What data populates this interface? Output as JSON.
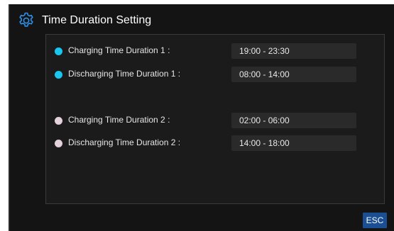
{
  "header": {
    "title": "Time Duration Setting",
    "icon": "gear-icon",
    "icon_color": "#2f8fe6"
  },
  "rows": [
    {
      "label": "Charging Time Duration 1 :",
      "value": "19:00 - 23:30",
      "dot_color": "#19c6ef"
    },
    {
      "label": "Discharging Time Duration 1 :",
      "value": "08:00 - 14:00",
      "dot_color": "#19c6ef"
    },
    {
      "label": "Charging Time Duration 2 :",
      "value": "02:00 - 06:00",
      "dot_color": "#e3d2dc"
    },
    {
      "label": "Discharging Time Duration 2 :",
      "value": "14:00 - 18:00",
      "dot_color": "#e3d2dc"
    }
  ],
  "footer": {
    "esc_label": "ESC",
    "esc_color": "#1a4f93"
  }
}
